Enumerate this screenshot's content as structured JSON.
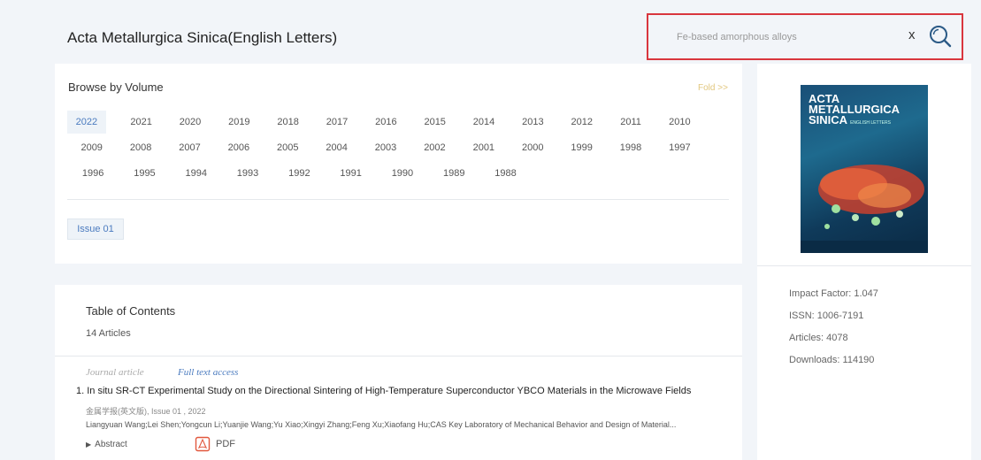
{
  "header": {
    "journal_title": "Acta Metallurgica Sinica(English Letters)",
    "search_value": "Fe-based amorphous alloys",
    "clear_label": "x"
  },
  "browse": {
    "title": "Browse by Volume",
    "fold_label": "Fold >>",
    "years": [
      [
        "2022",
        "2021",
        "2020",
        "2019",
        "2018",
        "2017",
        "2016",
        "2015",
        "2014",
        "2013",
        "2012",
        "2011",
        "2010"
      ],
      [
        "2009",
        "2008",
        "2007",
        "2006",
        "2005",
        "2004",
        "2003",
        "2002",
        "2001",
        "2000",
        "1999",
        "1998",
        "1997"
      ],
      [
        "1996",
        "1995",
        "1994",
        "1993",
        "1992",
        "1991",
        "1990",
        "1989",
        "1988"
      ]
    ],
    "selected_year": "2022",
    "issue_label": "Issue 01"
  },
  "cover": {
    "line1": "ACTA",
    "line2": "METALLURGICA",
    "line3": "SINICA",
    "line3_sub": "ENGLISH LETTERS"
  },
  "journal_meta": {
    "impact_factor": "Impact Factor: 1.047",
    "issn": "ISSN: 1006-7191",
    "articles": "Articles: 4078",
    "downloads": "Downloads: 114190"
  },
  "toc": {
    "title": "Table of Contents",
    "count": "14 Articles",
    "articles": [
      {
        "type": "Journal article",
        "access": "Full text access",
        "title": "1. In situ SR-CT Experimental Study on the Directional Sintering of High-Temperature Superconductor YBCO Materials in the Microwave Fields",
        "source": "金属学报(英文版), Issue 01 , 2022",
        "authors": "Liangyuan Wang;Lei Shen;Yongcun Li;Yuanjie Wang;Yu Xiao;Xingyi Zhang;Feng Xu;Xiaofang Hu;CAS Key Laboratory of Mechanical Behavior and Design of Material...",
        "abstract_label": "Abstract",
        "pdf_label": "PDF"
      }
    ]
  },
  "colors": {
    "accent": "#4b7bbf",
    "highlight_border": "#d9363e",
    "fold": "#e2c77e"
  }
}
